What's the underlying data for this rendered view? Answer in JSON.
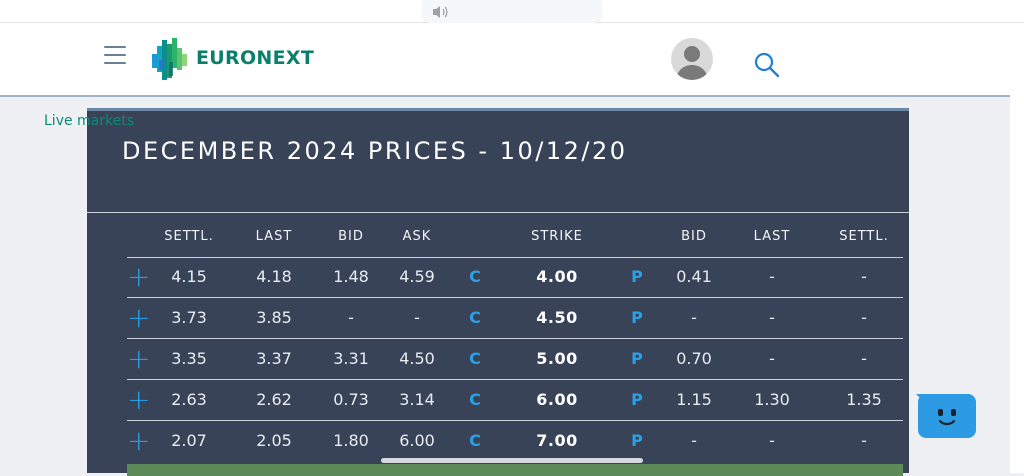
{
  "header": {
    "brand": "EURONEXT",
    "nav_link": "Live markets"
  },
  "panel": {
    "title": "DECEMBER 2024 PRICES - 10/12/20"
  },
  "table": {
    "headers": {
      "settl": "SETTL.",
      "last": "LAST",
      "bid": "BID",
      "ask": "ASK",
      "strike": "STRIKE",
      "put_bid": "BID",
      "put_last": "LAST",
      "put_settl": "SETTL."
    },
    "plus_symbol": "+",
    "call_flag": "C",
    "put_flag": "P",
    "rows": [
      {
        "settl": "4.15",
        "last": "4.18",
        "bid": "1.48",
        "ask": "4.59",
        "strike": "4.00",
        "put_bid": "0.41",
        "put_last": "-",
        "put_settl": "-"
      },
      {
        "settl": "3.73",
        "last": "3.85",
        "bid": "-",
        "ask": "-",
        "strike": "4.50",
        "put_bid": "-",
        "put_last": "-",
        "put_settl": "-"
      },
      {
        "settl": "3.35",
        "last": "3.37",
        "bid": "3.31",
        "ask": "4.50",
        "strike": "5.00",
        "put_bid": "0.70",
        "put_last": "-",
        "put_settl": "-"
      },
      {
        "settl": "2.63",
        "last": "2.62",
        "bid": "0.73",
        "ask": "3.14",
        "strike": "6.00",
        "put_bid": "1.15",
        "put_last": "1.30",
        "put_settl": "1.35"
      },
      {
        "settl": "2.07",
        "last": "2.05",
        "bid": "1.80",
        "ask": "6.00",
        "strike": "7.00",
        "put_bid": "-",
        "put_last": "-",
        "put_settl": "-"
      }
    ]
  },
  "colors": {
    "panel_bg": "#384358",
    "accent_blue": "#2aa0e6",
    "brand_green": "#0b7f6e",
    "row_highlight": "#5c8a58"
  },
  "icons": {
    "menu": "hamburger-menu-icon",
    "search": "search-icon",
    "avatar": "user-avatar-icon",
    "speaker": "speaker-icon",
    "chat": "chat-bot-icon"
  }
}
